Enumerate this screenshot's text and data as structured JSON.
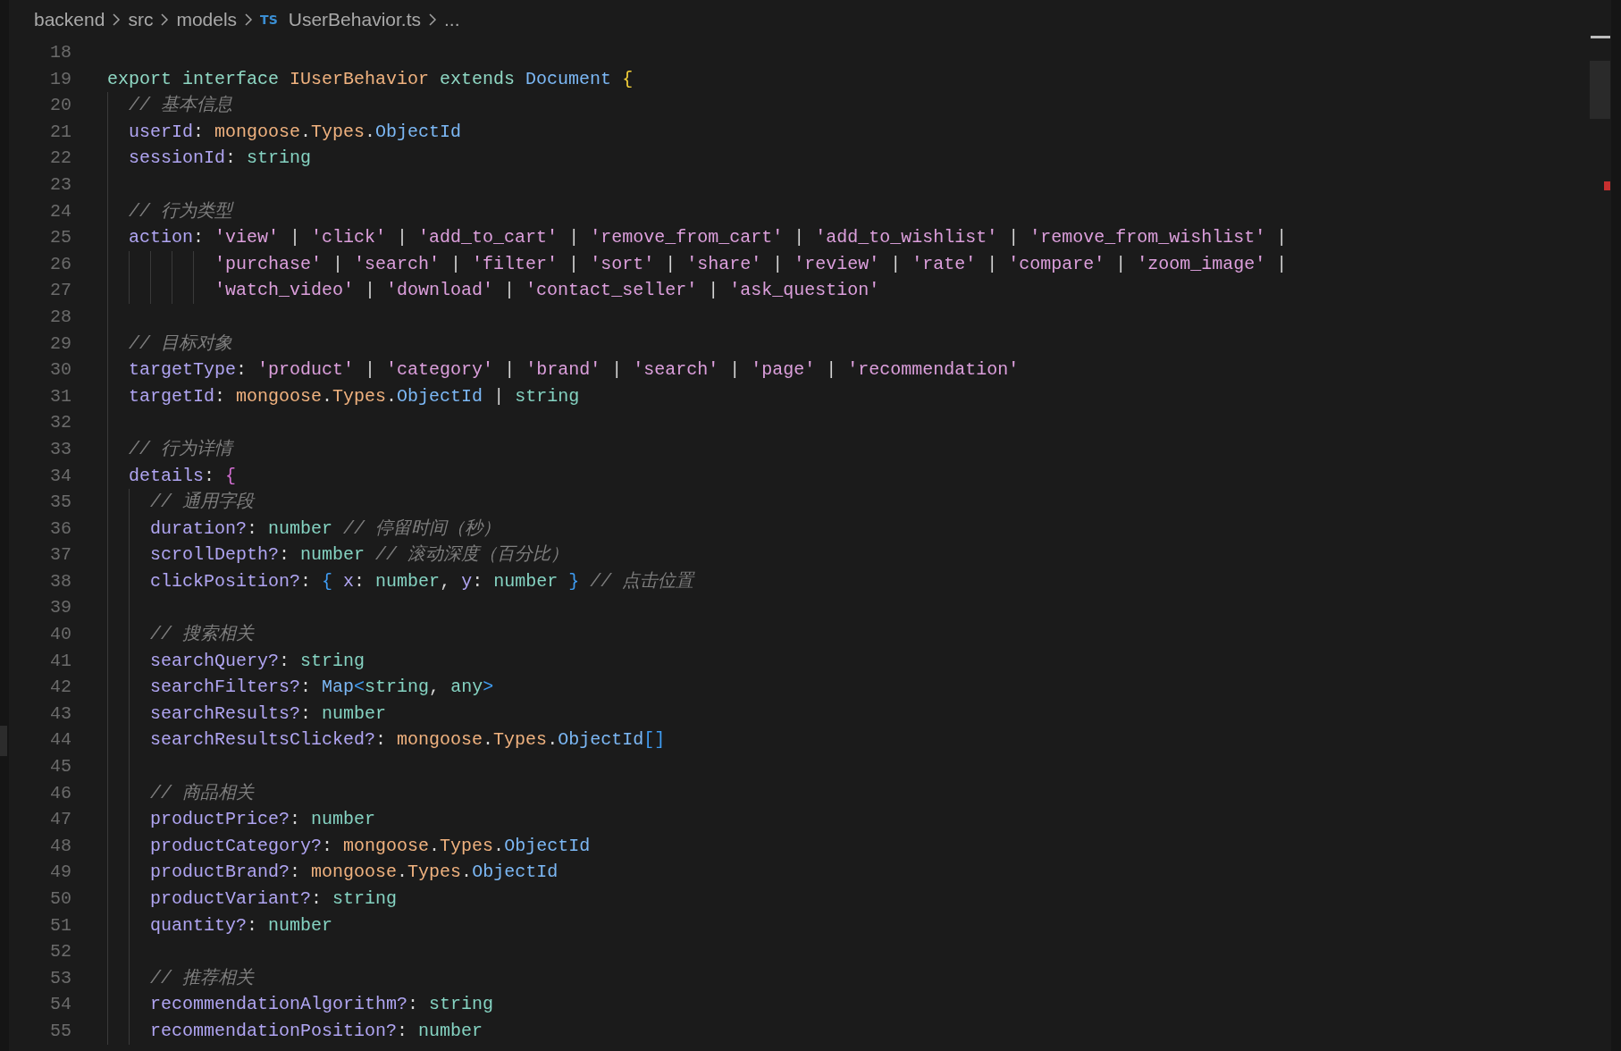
{
  "breadcrumb": {
    "items": [
      {
        "label": "backend",
        "kind": "folder"
      },
      {
        "label": "src",
        "kind": "folder"
      },
      {
        "label": "models",
        "kind": "folder"
      },
      {
        "label": "UserBehavior.ts",
        "kind": "file",
        "badge": "TS"
      },
      {
        "label": "...",
        "kind": "more"
      }
    ]
  },
  "editor": {
    "lines": [
      {
        "number": "18"
      },
      {
        "number": "19",
        "tokens": [
          {
            "kind": "keyword",
            "text": "export "
          },
          {
            "kind": "keyword",
            "text": "interface "
          },
          {
            "kind": "class",
            "text": "IUserBehavior "
          },
          {
            "kind": "keyword",
            "text": "extends "
          },
          {
            "kind": "interface",
            "text": "Document "
          },
          {
            "kind": "brace1",
            "text": "{"
          }
        ]
      },
      {
        "number": "20",
        "tokens": [
          {
            "kind": "comment",
            "text": "  // 基本信息"
          }
        ]
      },
      {
        "number": "21",
        "tokens": [
          {
            "kind": "property",
            "text": "  userId"
          },
          {
            "kind": "punct",
            "text": ": "
          },
          {
            "kind": "class",
            "text": "mongoose"
          },
          {
            "kind": "punct",
            "text": "."
          },
          {
            "kind": "class",
            "text": "Types"
          },
          {
            "kind": "punct",
            "text": "."
          },
          {
            "kind": "interface",
            "text": "ObjectId"
          }
        ]
      },
      {
        "number": "22",
        "tokens": [
          {
            "kind": "property",
            "text": "  sessionId"
          },
          {
            "kind": "punct",
            "text": ": "
          },
          {
            "kind": "type",
            "text": "string"
          }
        ]
      },
      {
        "number": "23"
      },
      {
        "number": "24",
        "tokens": [
          {
            "kind": "comment",
            "text": "  // 行为类型"
          }
        ]
      },
      {
        "number": "25",
        "tokens": [
          {
            "kind": "property",
            "text": "  action"
          },
          {
            "kind": "punct",
            "text": ": "
          },
          {
            "kind": "string",
            "text": "'view'"
          },
          {
            "kind": "punct",
            "text": " | "
          },
          {
            "kind": "string",
            "text": "'click'"
          },
          {
            "kind": "punct",
            "text": " | "
          },
          {
            "kind": "string",
            "text": "'add_to_cart'"
          },
          {
            "kind": "punct",
            "text": " | "
          },
          {
            "kind": "string",
            "text": "'remove_from_cart'"
          },
          {
            "kind": "punct",
            "text": " | "
          },
          {
            "kind": "string",
            "text": "'add_to_wishlist'"
          },
          {
            "kind": "punct",
            "text": " | "
          },
          {
            "kind": "string",
            "text": "'remove_from_wishlist'"
          },
          {
            "kind": "punct",
            "text": " |"
          }
        ]
      },
      {
        "number": "26",
        "tokens": [
          {
            "kind": "string",
            "text": "          'purchase'"
          },
          {
            "kind": "punct",
            "text": " | "
          },
          {
            "kind": "string",
            "text": "'search'"
          },
          {
            "kind": "punct",
            "text": " | "
          },
          {
            "kind": "string",
            "text": "'filter'"
          },
          {
            "kind": "punct",
            "text": " | "
          },
          {
            "kind": "string",
            "text": "'sort'"
          },
          {
            "kind": "punct",
            "text": " | "
          },
          {
            "kind": "string",
            "text": "'share'"
          },
          {
            "kind": "punct",
            "text": " | "
          },
          {
            "kind": "string",
            "text": "'review'"
          },
          {
            "kind": "punct",
            "text": " | "
          },
          {
            "kind": "string",
            "text": "'rate'"
          },
          {
            "kind": "punct",
            "text": " | "
          },
          {
            "kind": "string",
            "text": "'compare'"
          },
          {
            "kind": "punct",
            "text": " | "
          },
          {
            "kind": "string",
            "text": "'zoom_image'"
          },
          {
            "kind": "punct",
            "text": " |"
          }
        ]
      },
      {
        "number": "27",
        "tokens": [
          {
            "kind": "string",
            "text": "          'watch_video'"
          },
          {
            "kind": "punct",
            "text": " | "
          },
          {
            "kind": "string",
            "text": "'download'"
          },
          {
            "kind": "punct",
            "text": " | "
          },
          {
            "kind": "string",
            "text": "'contact_seller'"
          },
          {
            "kind": "punct",
            "text": " | "
          },
          {
            "kind": "string",
            "text": "'ask_question'"
          }
        ]
      },
      {
        "number": "28"
      },
      {
        "number": "29",
        "tokens": [
          {
            "kind": "comment",
            "text": "  // 目标对象"
          }
        ]
      },
      {
        "number": "30",
        "tokens": [
          {
            "kind": "property",
            "text": "  targetType"
          },
          {
            "kind": "punct",
            "text": ": "
          },
          {
            "kind": "string",
            "text": "'product'"
          },
          {
            "kind": "punct",
            "text": " | "
          },
          {
            "kind": "string",
            "text": "'category'"
          },
          {
            "kind": "punct",
            "text": " | "
          },
          {
            "kind": "string",
            "text": "'brand'"
          },
          {
            "kind": "punct",
            "text": " | "
          },
          {
            "kind": "string",
            "text": "'search'"
          },
          {
            "kind": "punct",
            "text": " | "
          },
          {
            "kind": "string",
            "text": "'page'"
          },
          {
            "kind": "punct",
            "text": " | "
          },
          {
            "kind": "string",
            "text": "'recommendation'"
          }
        ]
      },
      {
        "number": "31",
        "tokens": [
          {
            "kind": "property",
            "text": "  targetId"
          },
          {
            "kind": "punct",
            "text": ": "
          },
          {
            "kind": "class",
            "text": "mongoose"
          },
          {
            "kind": "punct",
            "text": "."
          },
          {
            "kind": "class",
            "text": "Types"
          },
          {
            "kind": "punct",
            "text": "."
          },
          {
            "kind": "interface",
            "text": "ObjectId"
          },
          {
            "kind": "punct",
            "text": " | "
          },
          {
            "kind": "type",
            "text": "string"
          }
        ]
      },
      {
        "number": "32"
      },
      {
        "number": "33",
        "tokens": [
          {
            "kind": "comment",
            "text": "  // 行为详情"
          }
        ]
      },
      {
        "number": "34",
        "tokens": [
          {
            "kind": "property",
            "text": "  details"
          },
          {
            "kind": "punct",
            "text": ": "
          },
          {
            "kind": "brace2",
            "text": "{"
          }
        ]
      },
      {
        "number": "35",
        "tokens": [
          {
            "kind": "comment",
            "text": "    // 通用字段"
          }
        ]
      },
      {
        "number": "36",
        "tokens": [
          {
            "kind": "property",
            "text": "    duration?"
          },
          {
            "kind": "punct",
            "text": ": "
          },
          {
            "kind": "type",
            "text": "number "
          },
          {
            "kind": "comment",
            "text": "// 停留时间（秒）"
          }
        ]
      },
      {
        "number": "37",
        "tokens": [
          {
            "kind": "property",
            "text": "    scrollDepth?"
          },
          {
            "kind": "punct",
            "text": ": "
          },
          {
            "kind": "type",
            "text": "number "
          },
          {
            "kind": "comment",
            "text": "// 滚动深度（百分比）"
          }
        ]
      },
      {
        "number": "38",
        "tokens": [
          {
            "kind": "property",
            "text": "    clickPosition?"
          },
          {
            "kind": "punct",
            "text": ": "
          },
          {
            "kind": "brace3",
            "text": "{ "
          },
          {
            "kind": "property",
            "text": "x"
          },
          {
            "kind": "punct",
            "text": ": "
          },
          {
            "kind": "type",
            "text": "number"
          },
          {
            "kind": "punct",
            "text": ", "
          },
          {
            "kind": "property",
            "text": "y"
          },
          {
            "kind": "punct",
            "text": ": "
          },
          {
            "kind": "type",
            "text": "number "
          },
          {
            "kind": "brace3",
            "text": "} "
          },
          {
            "kind": "comment",
            "text": "// 点击位置"
          }
        ]
      },
      {
        "number": "39"
      },
      {
        "number": "40",
        "tokens": [
          {
            "kind": "comment",
            "text": "    // 搜索相关"
          }
        ]
      },
      {
        "number": "41",
        "tokens": [
          {
            "kind": "property",
            "text": "    searchQuery?"
          },
          {
            "kind": "punct",
            "text": ": "
          },
          {
            "kind": "type",
            "text": "string"
          }
        ]
      },
      {
        "number": "42",
        "tokens": [
          {
            "kind": "property",
            "text": "    searchFilters?"
          },
          {
            "kind": "punct",
            "text": ": "
          },
          {
            "kind": "interface",
            "text": "Map"
          },
          {
            "kind": "brace3",
            "text": "<"
          },
          {
            "kind": "type",
            "text": "string"
          },
          {
            "kind": "punct",
            "text": ", "
          },
          {
            "kind": "type",
            "text": "any"
          },
          {
            "kind": "brace3",
            "text": ">"
          }
        ]
      },
      {
        "number": "43",
        "tokens": [
          {
            "kind": "property",
            "text": "    searchResults?"
          },
          {
            "kind": "punct",
            "text": ": "
          },
          {
            "kind": "type",
            "text": "number"
          }
        ]
      },
      {
        "number": "44",
        "tokens": [
          {
            "kind": "property",
            "text": "    searchResultsClicked?"
          },
          {
            "kind": "punct",
            "text": ": "
          },
          {
            "kind": "class",
            "text": "mongoose"
          },
          {
            "kind": "punct",
            "text": "."
          },
          {
            "kind": "class",
            "text": "Types"
          },
          {
            "kind": "punct",
            "text": "."
          },
          {
            "kind": "interface",
            "text": "ObjectId"
          },
          {
            "kind": "brace3",
            "text": "[]"
          }
        ]
      },
      {
        "number": "45"
      },
      {
        "number": "46",
        "tokens": [
          {
            "kind": "comment",
            "text": "    // 商品相关"
          }
        ]
      },
      {
        "number": "47",
        "tokens": [
          {
            "kind": "property",
            "text": "    productPrice?"
          },
          {
            "kind": "punct",
            "text": ": "
          },
          {
            "kind": "type",
            "text": "number"
          }
        ]
      },
      {
        "number": "48",
        "tokens": [
          {
            "kind": "property",
            "text": "    productCategory?"
          },
          {
            "kind": "punct",
            "text": ": "
          },
          {
            "kind": "class",
            "text": "mongoose"
          },
          {
            "kind": "punct",
            "text": "."
          },
          {
            "kind": "class",
            "text": "Types"
          },
          {
            "kind": "punct",
            "text": "."
          },
          {
            "kind": "interface",
            "text": "ObjectId"
          }
        ]
      },
      {
        "number": "49",
        "tokens": [
          {
            "kind": "property",
            "text": "    productBrand?"
          },
          {
            "kind": "punct",
            "text": ": "
          },
          {
            "kind": "class",
            "text": "mongoose"
          },
          {
            "kind": "punct",
            "text": "."
          },
          {
            "kind": "class",
            "text": "Types"
          },
          {
            "kind": "punct",
            "text": "."
          },
          {
            "kind": "interface",
            "text": "ObjectId"
          }
        ]
      },
      {
        "number": "50",
        "tokens": [
          {
            "kind": "property",
            "text": "    productVariant?"
          },
          {
            "kind": "punct",
            "text": ": "
          },
          {
            "kind": "type",
            "text": "string"
          }
        ]
      },
      {
        "number": "51",
        "tokens": [
          {
            "kind": "property",
            "text": "    quantity?"
          },
          {
            "kind": "punct",
            "text": ": "
          },
          {
            "kind": "type",
            "text": "number"
          }
        ]
      },
      {
        "number": "52"
      },
      {
        "number": "53",
        "tokens": [
          {
            "kind": "comment",
            "text": "    // 推荐相关"
          }
        ]
      },
      {
        "number": "54",
        "tokens": [
          {
            "kind": "property",
            "text": "    recommendationAlgorithm?"
          },
          {
            "kind": "punct",
            "text": ": "
          },
          {
            "kind": "type",
            "text": "string"
          }
        ]
      },
      {
        "number": "55",
        "tokens": [
          {
            "kind": "property",
            "text": "    recommendationPosition?"
          },
          {
            "kind": "punct",
            "text": ": "
          },
          {
            "kind": "type",
            "text": "number"
          }
        ]
      }
    ]
  }
}
